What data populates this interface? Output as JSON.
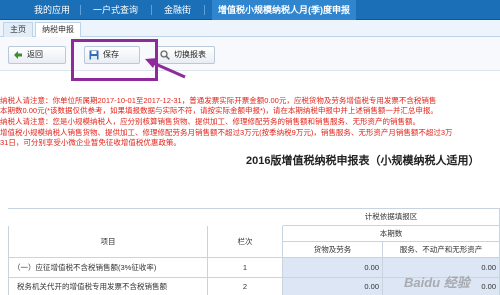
{
  "topnav": {
    "items": [
      "我的应用",
      "一户式查询",
      "金融街"
    ],
    "active_title": "增值税小规模纳税人月(季)度申报"
  },
  "tabs": [
    "主页",
    "纳税申报"
  ],
  "toolbar": {
    "back_label": "返回",
    "save_label": "保存",
    "switch_label": "切换报表"
  },
  "notice_lines": [
    "纳税人请注意：你单位所属期2017-10-01至2017-12-31，普通发票实际开票金额0.00元，应税货物及劳务增值税专用发票不含税销售",
    "本期数0.00元(*该数据仅供参考，如果填报数据与实际不符，请按实际金额申报*)，请在本期纳税申报中并上述销售额一并汇总申报。",
    "纳税人请注意：您是小规模纳税人，应分别核算销售货物、提供加工、修理修配劳务的销售额和销售服务、无形资产的销售额。",
    "增值税小规模纳税人销售货物、提供加工、修理修配劳务月销售额不超过3万元(按季纳税9万元)，销售服务、无形资产月销售额不超过3万",
    "31日，可分别享受小微企业暂免征收增值税优惠政策。"
  ],
  "form_title": "2016版增值税纳税申报表（小规模纳税人适用）",
  "table": {
    "group_header": "计税依据填报区",
    "col_item": "项目",
    "col_row": "栏次",
    "col_this_period": "本期数",
    "col_goods": "货物及劳务",
    "col_services": "服务、不动产和无形资产",
    "rows": [
      {
        "item": "（一）应征增值税不含税销售额(3%征收率)",
        "row_no": "1",
        "goods": "0.00",
        "services": "0.00"
      },
      {
        "item": "税务机关代开的增值税专用发票不含税销售额",
        "row_no": "2",
        "goods": "0.00",
        "services": "0.00"
      }
    ]
  },
  "watermark": "Baidu 经验"
}
